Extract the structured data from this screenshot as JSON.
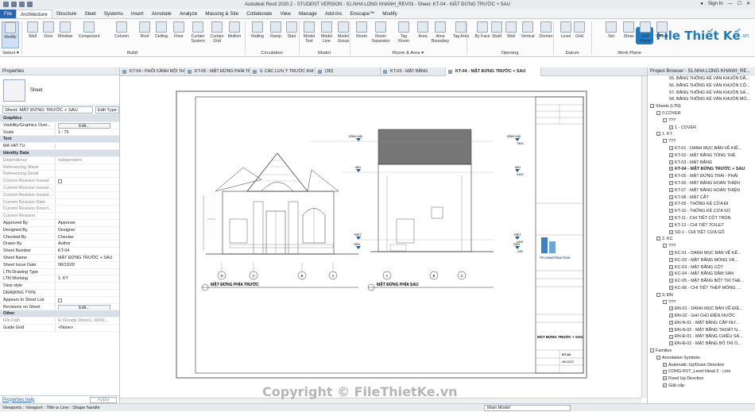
{
  "title_bar": {
    "title": "Autodesk Revit 2020.2 - STUDENT VERSION - 51.NHA LONG KHANH_REV03 - Sheet: KT-04 - MẶT ĐỨNG TRƯỚC + SAU",
    "signin": "Sign In"
  },
  "ribbon_tabs": [
    "File",
    "Architecture",
    "Structure",
    "Steel",
    "Systems",
    "Insert",
    "Annotate",
    "Analyze",
    "Massing & Site",
    "Collaborate",
    "View",
    "Manage",
    "Add-Ins",
    "Enscape™",
    "Modify"
  ],
  "ribbon": {
    "buttons": [
      "Modify",
      "Wall",
      "Door",
      "Window",
      "Component",
      "Column",
      "Roof",
      "Ceiling",
      "Floor",
      "Curtain System",
      "Curtain Grid",
      "Mullion",
      "Railing",
      "Ramp",
      "Stair",
      "Model Text",
      "Model Line",
      "Model Group",
      "Room",
      "Room Separator",
      "Tag Room",
      "Area",
      "Area Boundary",
      "Tag Area",
      "By Face",
      "Shaft",
      "Wall",
      "Vertical",
      "Dormer",
      "Level",
      "Grid",
      "Set",
      "Show",
      "Ref Plane",
      "Viewer"
    ],
    "groups": [
      "Select ▾",
      "Build",
      "Circulation",
      "Model",
      "Room & Area ▾",
      "Opening",
      "Datum",
      "Work Plane"
    ]
  },
  "logo": {
    "text": "File Thiết Kế",
    "suffix": ".vn"
  },
  "properties": {
    "header": "Properties",
    "type_name": "Sheet",
    "selector": "Sheet: MẶT ĐỨNG TRƯỚC + SAU",
    "edit_type": "Edit Type",
    "rows": [
      {
        "k": "Graphics",
        "v": "",
        "cat": true
      },
      {
        "k": "Visibility/Graphics Over...",
        "v": "Edit...",
        "btn": true
      },
      {
        "k": "Scale",
        "v": "1 : 75"
      },
      {
        "k": "Text",
        "v": "",
        "cat": true
      },
      {
        "k": "MA VAT TU",
        "v": ""
      },
      {
        "k": "Identity Data",
        "v": "",
        "cat": true
      },
      {
        "k": "Dependency",
        "v": "Independent",
        "grey": true
      },
      {
        "k": "Referencing Sheet",
        "v": "",
        "grey": true
      },
      {
        "k": "Referencing Detail",
        "v": "",
        "grey": true
      },
      {
        "k": "Current Revision Issued",
        "v": "",
        "grey": true,
        "chk": true
      },
      {
        "k": "Current Revision Issued ...",
        "v": "",
        "grey": true
      },
      {
        "k": "Current Revision Issued ...",
        "v": "",
        "grey": true
      },
      {
        "k": "Current Revision Date",
        "v": "",
        "grey": true
      },
      {
        "k": "Current Revision Descri...",
        "v": "",
        "grey": true
      },
      {
        "k": "Current Revision",
        "v": "",
        "grey": true
      },
      {
        "k": "Approved By",
        "v": "Approver"
      },
      {
        "k": "Designed By",
        "v": "Designer"
      },
      {
        "k": "Checked By",
        "v": "Checker"
      },
      {
        "k": "Drawn By",
        "v": "Author"
      },
      {
        "k": "Sheet Number",
        "v": "KT-04"
      },
      {
        "k": "Sheet Name",
        "v": "MẶT ĐỨNG TRƯỚC + SAU"
      },
      {
        "k": "Sheet Issue Date",
        "v": "08/13/20"
      },
      {
        "k": "LTN Drawing Type",
        "v": ""
      },
      {
        "k": "LTN Working",
        "v": "1. KT"
      },
      {
        "k": "View style",
        "v": ""
      },
      {
        "k": "DRAWING TYPE",
        "v": ""
      },
      {
        "k": "Appears In Sheet List",
        "v": "",
        "chk": true
      },
      {
        "k": "Revisions on Sheet",
        "v": "Edit...",
        "btn": true
      },
      {
        "k": "Other",
        "v": "",
        "cat": true
      },
      {
        "k": "File Path",
        "v": "E:\\Google Drive\\1. WOR...",
        "grey": true
      },
      {
        "k": "Guide Grid",
        "v": "<None>"
      }
    ],
    "help": "Properties help",
    "apply": "Apply"
  },
  "view_tabs": [
    "KT-04 - PHỐI CẢNH NỘI THẤT TẦ...",
    "KT-05 - MẶT ĐỨNG PHÍA TRƯỚC",
    "0. CÁC LƯU Ý TRƯỚC KHI BẮT ĐẦU...",
    "(3D)",
    "KT-03 - MẶT BẰNG",
    "KT-04 - MẶT ĐỨNG TRƯỚC + SAU"
  ],
  "drawing": {
    "front_title": "MẶT ĐỨNG PHÍA TRƯỚC",
    "back_title": "MẶT ĐỨNG PHÍA SAU",
    "levels": [
      "ĐỈNH MÁI",
      "MÁI",
      "TRỆT",
      "SÂN"
    ],
    "level_values": [
      "7800",
      "4100",
      "±000",
      "-150"
    ],
    "grid_labels": [
      "A",
      "B",
      "C",
      "D"
    ],
    "company": "TP CONSTRUCTION",
    "sheet_name": "MẶT ĐỨNG TRƯỚC + SAU",
    "sheet_number": "KT-04",
    "date": "08/13/20"
  },
  "browser": {
    "header": "Project Browser - 51.NHA LONG KHANH_RE...",
    "items": [
      {
        "t": "55. BẢNG THỐNG KÊ VÁN KHUÔN DẦ...",
        "l": 3
      },
      {
        "t": "56. BẢNG THỐNG KÊ VÁN KHUÔN CỘ...",
        "l": 3
      },
      {
        "t": "57. BẢNG THỐNG KÊ VÁN KHUÔN SÀ...",
        "l": 3
      },
      {
        "t": "58. BẢNG THỐNG KÊ VÁN KHUÔN MÓ...",
        "l": 3
      },
      {
        "t": "Sheets (LTN)",
        "l": 0,
        "tg": "-"
      },
      {
        "t": "0.COVER",
        "l": 1,
        "tg": "-"
      },
      {
        "t": "???",
        "l": 2,
        "tg": "-"
      },
      {
        "t": "1 - COVER",
        "l": 3,
        "tg": "+"
      },
      {
        "t": "1. KT",
        "l": 1,
        "tg": "-"
      },
      {
        "t": "???",
        "l": 2,
        "tg": "-"
      },
      {
        "t": "KT-01 - DANH MỤC BẢN VẼ KIẾ...",
        "l": 3,
        "tg": "+"
      },
      {
        "t": "KT-02 - MẶT BẰNG TỔNG THỂ",
        "l": 3,
        "tg": "+"
      },
      {
        "t": "KT-03 - MẶT BẰNG",
        "l": 3,
        "tg": "+"
      },
      {
        "t": "KT-04 - MẶT ĐỨNG TRƯỚC + SAU",
        "l": 3,
        "tg": "+",
        "bold": true
      },
      {
        "t": "KT-05 - MẶT ĐỨNG TRÁI - PHẢI",
        "l": 3,
        "tg": "+"
      },
      {
        "t": "KT-06 - MẶT BẰNG HOÀN THIỆN",
        "l": 3,
        "tg": "+"
      },
      {
        "t": "KT-07 - MẶT BẰNG HOÀN THIỆN",
        "l": 3,
        "tg": "+"
      },
      {
        "t": "KT-08 - MẶT CẮT",
        "l": 3,
        "tg": "+"
      },
      {
        "t": "KT-09 - THỐNG KÊ CỬA ĐI",
        "l": 3,
        "tg": "+"
      },
      {
        "t": "KT-10 - THỐNG KÊ CỬA SỔ",
        "l": 3,
        "tg": "+"
      },
      {
        "t": "KT-11 - CHI TIẾT CỘT TRÒN",
        "l": 3,
        "tg": "+"
      },
      {
        "t": "KT-12 - CHI TIẾT TOILET",
        "l": 3,
        "tg": "+"
      },
      {
        "t": "SD-1 - CHI TIẾT CỬA GỖ",
        "l": 3,
        "tg": "+"
      },
      {
        "t": "2. KC",
        "l": 1,
        "tg": "-"
      },
      {
        "t": "???",
        "l": 2,
        "tg": "-"
      },
      {
        "t": "KC-01 - DANH MỤC BẢN VẼ KẾ...",
        "l": 3,
        "tg": "+"
      },
      {
        "t": "KC-02 - MẶT BẰNG MÓNG VÀ...",
        "l": 3,
        "tg": "+"
      },
      {
        "t": "KC-03 - MẶT BẰNG CỘT",
        "l": 3,
        "tg": "+"
      },
      {
        "t": "KC-04 - MẶT BẰNG DẦM SÀN",
        "l": 3,
        "tg": "+"
      },
      {
        "t": "KC-05 - MẶT BẰNG BỐT TRÍ THÉ...",
        "l": 3,
        "tg": "+"
      },
      {
        "t": "KC-06 - CHI TIẾT THÉP MÓNG, ...",
        "l": 3,
        "tg": "+"
      },
      {
        "t": "3. ĐN",
        "l": 1,
        "tg": "-"
      },
      {
        "t": "???",
        "l": 2,
        "tg": "-"
      },
      {
        "t": "ĐN-01 - DANH MỤC BẢN VẼ ĐIỆ...",
        "l": 3,
        "tg": "+"
      },
      {
        "t": "ĐN-02 - GHI CHÚ ĐIỆN NƯỚC",
        "l": 3,
        "tg": "+"
      },
      {
        "t": "ĐN-N-01 - MẶT BẰNG CẤP NƯ...",
        "l": 3,
        "tg": "+"
      },
      {
        "t": "ĐN-N-02 - MẶT BẰNG THOÁT N...",
        "l": 3,
        "tg": "+"
      },
      {
        "t": "ĐN-Đ-01 - MẶT BẰNG CHIẾU SÁ...",
        "l": 3,
        "tg": "+"
      },
      {
        "t": "ĐN-Đ-02 - MẶT BẰNG BỐ TRÍ Ổ...",
        "l": 3,
        "tg": "+"
      },
      {
        "t": "Families",
        "l": 0,
        "tg": "-"
      },
      {
        "t": "Annotation Symbols",
        "l": 1,
        "tg": "-"
      },
      {
        "t": "Automatic Up/Down Direction",
        "l": 2,
        "tg": "+"
      },
      {
        "t": "CONG-RVT_Level Head 2 - Line",
        "l": 2,
        "tg": "+"
      },
      {
        "t": "Fixed Up Direction",
        "l": 2,
        "tg": "+"
      },
      {
        "t": "Giật cấp",
        "l": 2,
        "tg": "+"
      }
    ]
  },
  "status": {
    "text": "Viewports : Viewport : Title w Line : Shape handle",
    "model": "Main Model"
  },
  "watermark": "Copyright © FileThietKe.vn"
}
